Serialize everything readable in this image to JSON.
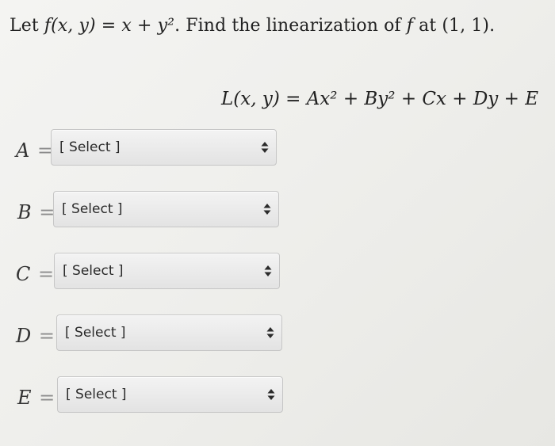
{
  "question": {
    "prefix": "Let ",
    "function_expr": "f(x, y) = x + y²",
    "middle": ". Find the linearization of ",
    "f": "f",
    "at": " at ",
    "point": "(1, 1)",
    "suffix": "."
  },
  "formula": "L(x, y) = Ax² + By² + Cx + Dy + E",
  "rows": [
    {
      "var": "A",
      "eq": "=",
      "value": "[ Select ]"
    },
    {
      "var": "B",
      "eq": "=",
      "value": "[ Select ]"
    },
    {
      "var": "C",
      "eq": "=",
      "value": "[ Select ]"
    },
    {
      "var": "D",
      "eq": "=",
      "value": "[ Select ]"
    },
    {
      "var": "E",
      "eq": "=",
      "value": "[ Select ]"
    }
  ],
  "icons": {
    "select_arrow": "up-down-arrows-icon"
  }
}
